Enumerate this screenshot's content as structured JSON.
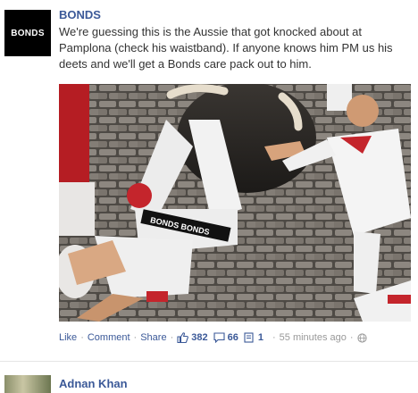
{
  "post": {
    "author": "BONDS",
    "avatar_logo_text": "BONDS",
    "message": "We're guessing this is the Aussie that got knocked about at Pamplona (check his waistband). If anyone knows him PM us his deets and we'll get a Bonds care pack out to him.",
    "photo_waistband_text": "BONDS BONDS",
    "actions": {
      "like": "Like",
      "comment": "Comment",
      "share": "Share",
      "separator": "·",
      "likes_count": "382",
      "comments_count": "66",
      "shares_count": "1",
      "timestamp": "55 minutes ago"
    }
  },
  "next_post": {
    "author": "Adnan Khan"
  },
  "colors": {
    "link": "#3b5998",
    "meta": "#999999",
    "avatar_bg": "#000000"
  },
  "icons": [
    "thumbs-up-icon",
    "comment-bubble-icon",
    "share-icon",
    "globe-icon"
  ]
}
